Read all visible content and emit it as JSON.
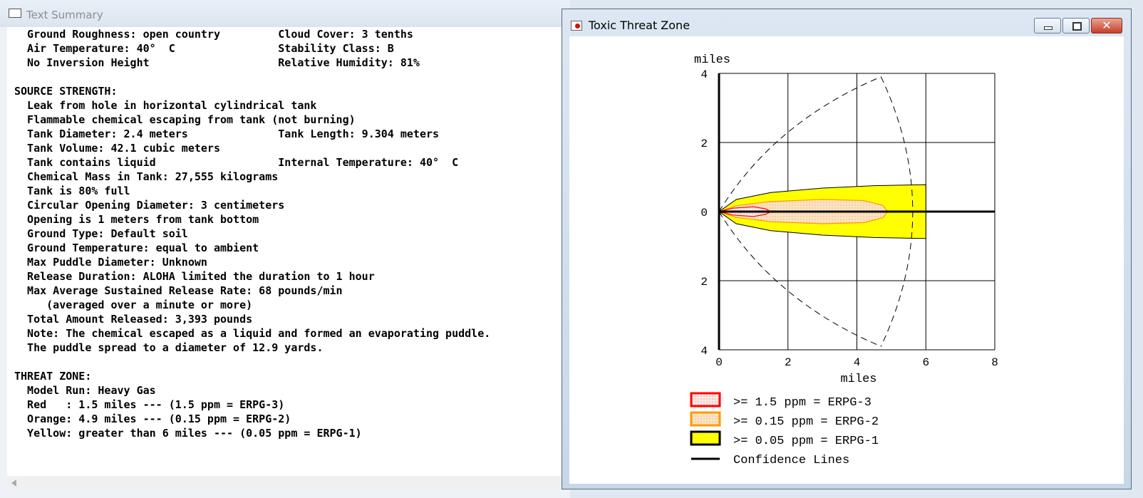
{
  "text_summary": {
    "title": "Text Summary",
    "lines": [
      "  Ground Roughness: open country         Cloud Cover: 3 tenths",
      "  Air Temperature: 40°  C                Stability Class: B",
      "  No Inversion Height                    Relative Humidity: 81%",
      "",
      "SOURCE STRENGTH:",
      "  Leak from hole in horizontal cylindrical tank",
      "  Flammable chemical escaping from tank (not burning)",
      "  Tank Diameter: 2.4 meters              Tank Length: 9.304 meters",
      "  Tank Volume: 42.1 cubic meters",
      "  Tank contains liquid                   Internal Temperature: 40°  C",
      "  Chemical Mass in Tank: 27,555 kilograms",
      "  Tank is 80% full",
      "  Circular Opening Diameter: 3 centimeters",
      "  Opening is 1 meters from tank bottom",
      "  Ground Type: Default soil",
      "  Ground Temperature: equal to ambient",
      "  Max Puddle Diameter: Unknown",
      "  Release Duration: ALOHA limited the duration to 1 hour",
      "  Max Average Sustained Release Rate: 68 pounds/min",
      "     (averaged over a minute or more)",
      "  Total Amount Released: 3,393 pounds",
      "  Note: The chemical escaped as a liquid and formed an evaporating puddle.",
      "  The puddle spread to a diameter of 12.9 yards.",
      "",
      "THREAT ZONE:",
      "  Model Run: Heavy Gas",
      "  Red   : 1.5 miles --- (1.5 ppm = ERPG-3)",
      "  Orange: 4.9 miles --- (0.15 ppm = ERPG-2)",
      "  Yellow: greater than 6 miles --- (0.05 ppm = ERPG-1)"
    ]
  },
  "threat_zone_window": {
    "title": "Toxic Threat Zone",
    "close_label": "✕"
  },
  "chart_data": {
    "type": "area",
    "ylabel": "miles",
    "xlabel": "miles",
    "xlim": [
      0,
      8
    ],
    "ylim": [
      -4,
      4
    ],
    "x_ticks": [
      "0",
      "2",
      "4",
      "6",
      "8"
    ],
    "y_ticks": [
      "4",
      "2",
      "0",
      "2",
      "4"
    ],
    "grid": true,
    "zones": [
      {
        "name": ">= 0.05 ppm = ERPG-1",
        "color": "#ffff00",
        "stroke": "#000000",
        "max_x": 6.0,
        "x": [
          0,
          0.5,
          1.5,
          3,
          4.5,
          6
        ],
        "half_width": [
          0,
          0.35,
          0.55,
          0.68,
          0.75,
          0.78
        ]
      },
      {
        "name": ">= 0.15 ppm = ERPG-2",
        "color": "#fde3c2",
        "stroke": "#ff9900",
        "max_x": 4.9,
        "x": [
          0,
          0.5,
          1.5,
          3,
          4.2,
          4.75,
          4.9
        ],
        "half_width": [
          0,
          0.17,
          0.29,
          0.35,
          0.32,
          0.18,
          0
        ]
      },
      {
        "name": ">= 1.5 ppm = ERPG-3",
        "color": "#fbe8e4",
        "stroke": "#ff0000",
        "max_x": 1.5,
        "x": [
          0,
          0.4,
          1.0,
          1.35,
          1.5
        ],
        "half_width": [
          0,
          0.1,
          0.14,
          0.08,
          0
        ]
      }
    ],
    "confidence_lines": {
      "name": "Confidence Lines",
      "max_x": 6.0,
      "apex_x": 4.7,
      "apex_y": 3.9
    },
    "legend": [
      {
        "label": ">= 1.5 ppm = ERPG-3",
        "fill": "#fbe8e4",
        "stroke": "#ff0000"
      },
      {
        "label": ">= 0.15 ppm = ERPG-2",
        "fill": "#fde3c2",
        "stroke": "#ff9900"
      },
      {
        "label": ">= 0.05 ppm = ERPG-1",
        "fill": "#ffff00",
        "stroke": "#000000"
      },
      {
        "label": "Confidence Lines",
        "fill": "",
        "stroke": "#000000"
      }
    ]
  }
}
